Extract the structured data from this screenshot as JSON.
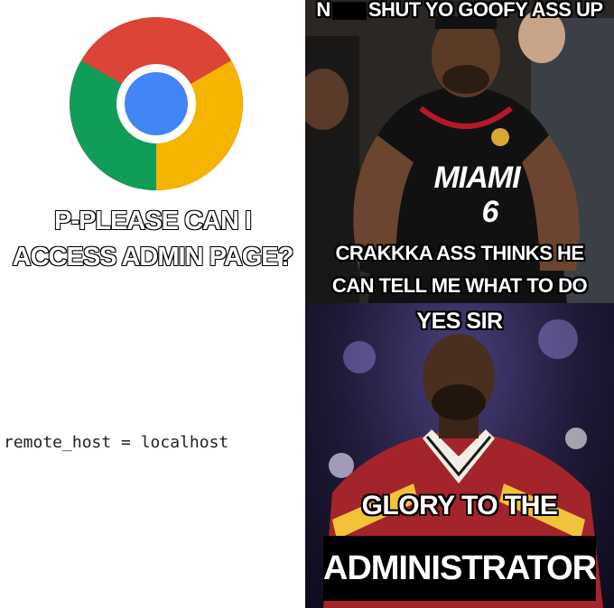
{
  "left_panel": {
    "logo_icon": "chrome-logo-icon",
    "caption_line1": "P-PLEASE CAN I",
    "caption_line2": "ACCESS ADMIN PAGE?",
    "code_text": "remote_host = localhost"
  },
  "top_panel": {
    "top_text_prefix": "N",
    "top_text_suffix": "SHUT YO GOOFY ASS UP",
    "jersey_team": "MIAMI",
    "jersey_number": "6",
    "bottom_line1": "CRAKKKA ASS THINKS HE",
    "bottom_line2": "CAN TELL ME WHAT TO DO"
  },
  "bottom_panel": {
    "top_text": "YES SIR",
    "line1": "GLORY TO THE",
    "admin_label": "ADMINISTRATOR"
  },
  "colors": {
    "chrome_red": "#DB4437",
    "chrome_green": "#0F9D58",
    "chrome_yellow": "#F4B400",
    "chrome_blue": "#4285F4",
    "jersey_red": "#b5182a"
  }
}
